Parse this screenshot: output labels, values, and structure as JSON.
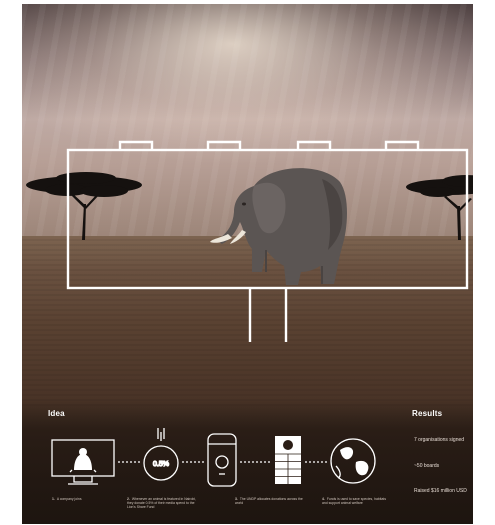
{
  "poster": {
    "idea_title": "Idea",
    "results_title": "Results",
    "percentage_label": "0.5%",
    "un_logo_text": [
      "U",
      "N",
      "D",
      "P"
    ],
    "results": [
      "7 organisations signed",
      "~50 boards",
      "Raised $16 million USD"
    ],
    "steps": [
      {
        "num": "1.",
        "text": "A company joins"
      },
      {
        "num": "2.",
        "text": "Whenever an animal is featured in Nairobi, they donate 0.5% of their media spend to the Lion's Share Fund"
      },
      {
        "num": "3.",
        "text": "The UNDP allocates donations across the world"
      },
      {
        "num": "4.",
        "text": "Funds is used to save species, habitats and support animal welfare"
      }
    ],
    "colors": {
      "line": "#ffffff",
      "text": "#e8ded6"
    }
  }
}
